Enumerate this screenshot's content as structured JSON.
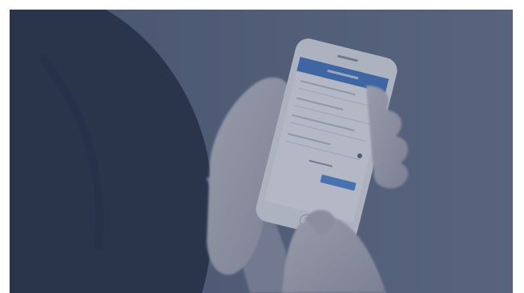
{
  "photo": {
    "tint_color": "#3e4a66",
    "background_color": "#5d6a82",
    "phone_header_color": "#3f74c4",
    "phone_button_color": "#4d86d6",
    "phone_screen_color": "#f1f3f6",
    "phone_body_color": "#e8eaee",
    "sleeve_color": "#1f2a3e",
    "skin_color": "#b9b8c2"
  }
}
